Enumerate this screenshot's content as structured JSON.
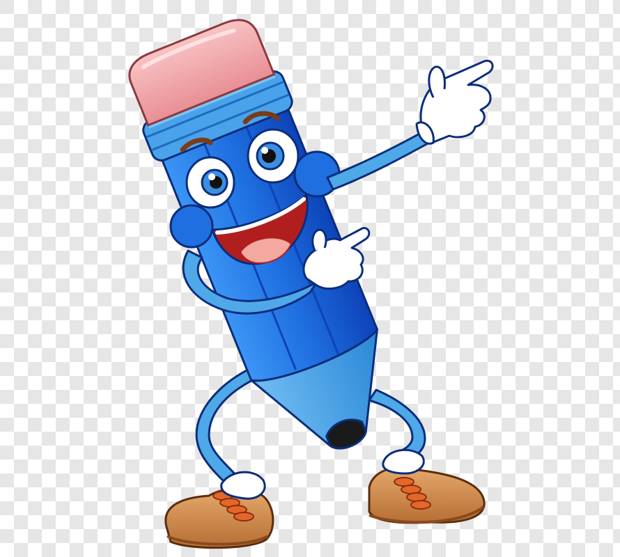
{
  "scene": {
    "subject": "pencil-mascot",
    "background": "transparency-checkerboard",
    "colors": {
      "checker_light": "#ffffff",
      "checker_dark": "#e6e6e6",
      "body_blue": "#1f6fe0",
      "body_blue_dark": "#0d43b8",
      "body_blue_light": "#3b95f5",
      "band_blue": "#4aa3ea",
      "band_blue_light": "#7cc4f3",
      "eraser_pink": "#f2a5a8",
      "eraser_pink_light": "#f8c3c4",
      "wood_blue": "#3ea4ea",
      "lead_black": "#1a1a1a",
      "limb_blue": "#4fa8e8",
      "glove_white": "#ffffff",
      "shoe_tan": "#d08a4e",
      "shoe_tan_light": "#e6a96b",
      "lace_orange": "#e4672a",
      "mouth_red": "#b11e1e",
      "tongue_pink": "#f3a8a0",
      "eye_blue": "#3c8ee0",
      "brow_brown": "#7a3b18",
      "outline": "#0b2d7a"
    },
    "icons": [
      "pointing-glove-icon",
      "shoe-icon",
      "eye-icon"
    ]
  }
}
